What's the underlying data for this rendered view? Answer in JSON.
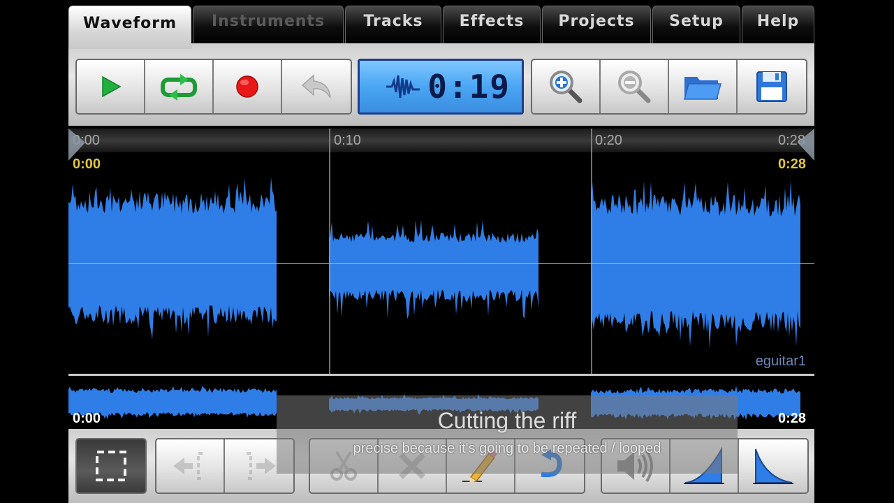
{
  "tabs": [
    {
      "label": "Waveform",
      "active": true
    },
    {
      "label": "Instruments",
      "active": false,
      "disabled": true
    },
    {
      "label": "Tracks",
      "active": false
    },
    {
      "label": "Effects",
      "active": false
    },
    {
      "label": "Projects",
      "active": false
    },
    {
      "label": "Setup",
      "active": false
    },
    {
      "label": "Help",
      "active": false
    }
  ],
  "toolbar": {
    "buttons": [
      {
        "name": "play",
        "icon": "play-icon",
        "color": "#2aa640"
      },
      {
        "name": "loop",
        "icon": "loop-icon",
        "color": "#2aa640"
      },
      {
        "name": "record",
        "icon": "record-icon",
        "color": "#e11b1b"
      },
      {
        "name": "undo",
        "icon": "undo-icon",
        "color": "#a8a8a8"
      },
      {
        "name": "zoom-in",
        "icon": "zoom-in-icon"
      },
      {
        "name": "zoom-out",
        "icon": "zoom-out-icon"
      },
      {
        "name": "open",
        "icon": "folder-icon"
      },
      {
        "name": "save",
        "icon": "save-icon"
      }
    ],
    "time_display": "0:19"
  },
  "timeline": {
    "ruler_labels": [
      "0:00",
      "0:10",
      "0:20",
      "0:28"
    ],
    "selection_start": "0:00",
    "selection_end": "0:28",
    "track_name": "eguitar1",
    "overview_start": "0:00",
    "overview_end": "0:28",
    "waveform_color": "#2f7de6"
  },
  "bottom_toolbar": {
    "buttons": [
      {
        "name": "select-all",
        "icon": "selection-icon",
        "pressed": true
      },
      {
        "name": "move-left",
        "icon": "move-left-icon"
      },
      {
        "name": "move-right",
        "icon": "move-right-icon"
      },
      {
        "name": "cut",
        "icon": "scissors-icon"
      },
      {
        "name": "delete",
        "icon": "delete-icon"
      },
      {
        "name": "draw",
        "icon": "pencil-icon"
      },
      {
        "name": "redo",
        "icon": "redo-icon"
      },
      {
        "name": "volume",
        "icon": "volume-icon"
      },
      {
        "name": "fade-in",
        "icon": "fade-in-icon"
      },
      {
        "name": "fade-out",
        "icon": "fade-out-icon"
      }
    ]
  },
  "caption": {
    "title": "Cutting the riff",
    "subtitle": "precise because it's going to be repeated / looped"
  }
}
